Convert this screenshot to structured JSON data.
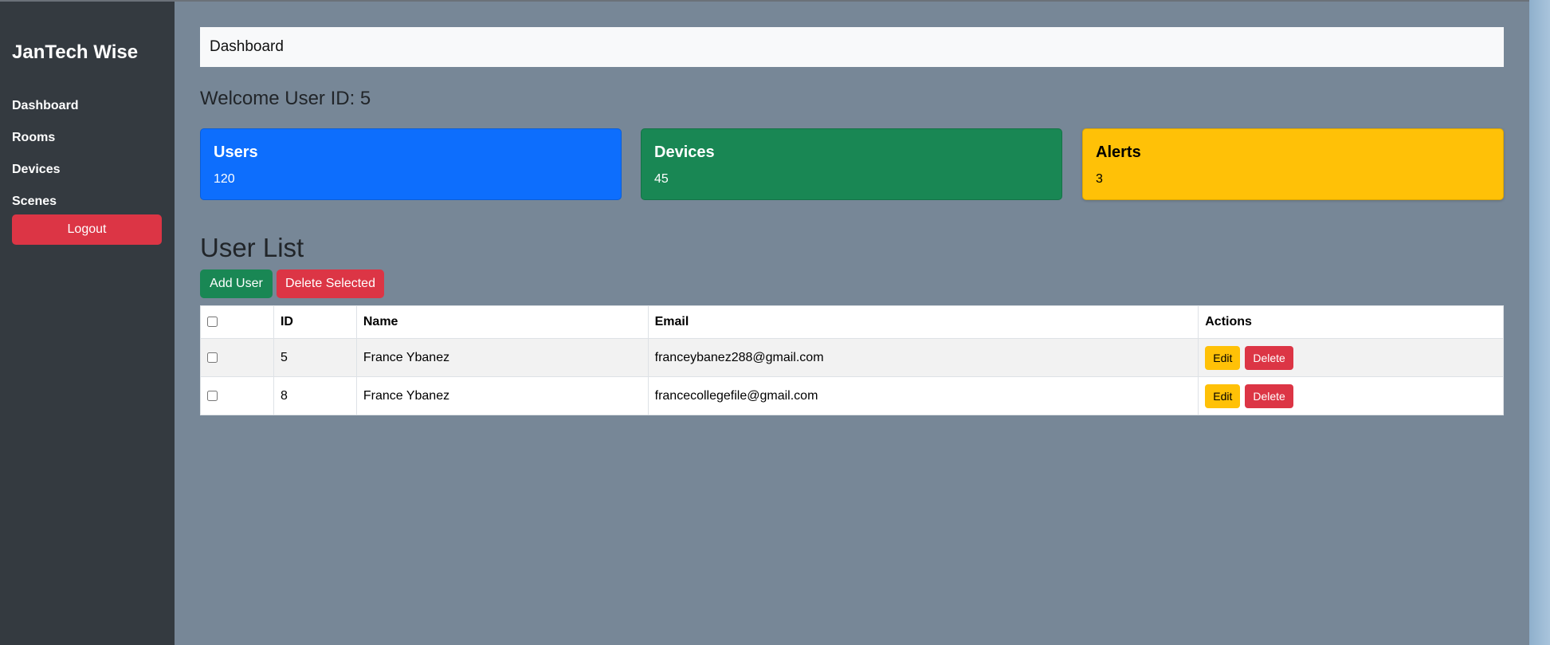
{
  "sidebar": {
    "brand": "JanTech Wise",
    "items": [
      {
        "label": "Dashboard"
      },
      {
        "label": "Rooms"
      },
      {
        "label": "Devices"
      },
      {
        "label": "Scenes"
      }
    ],
    "logout_label": "Logout"
  },
  "header": {
    "title": "Dashboard"
  },
  "welcome": "Welcome User ID: 5",
  "cards": [
    {
      "title": "Users",
      "value": "120",
      "color": "#0d6efd"
    },
    {
      "title": "Devices",
      "value": "45",
      "color": "#198754"
    },
    {
      "title": "Alerts",
      "value": "3",
      "color": "#ffc107"
    }
  ],
  "user_list": {
    "title": "User List",
    "add_label": "Add User",
    "delete_selected_label": "Delete Selected",
    "columns": [
      "ID",
      "Name",
      "Email",
      "Actions"
    ],
    "rows": [
      {
        "id": "5",
        "name": "France Ybanez",
        "email": "franceybanez288@gmail.com",
        "edit_label": "Edit",
        "delete_label": "Delete"
      },
      {
        "id": "8",
        "name": "France Ybanez",
        "email": "francecollegefile@gmail.com",
        "edit_label": "Edit",
        "delete_label": "Delete"
      }
    ]
  }
}
